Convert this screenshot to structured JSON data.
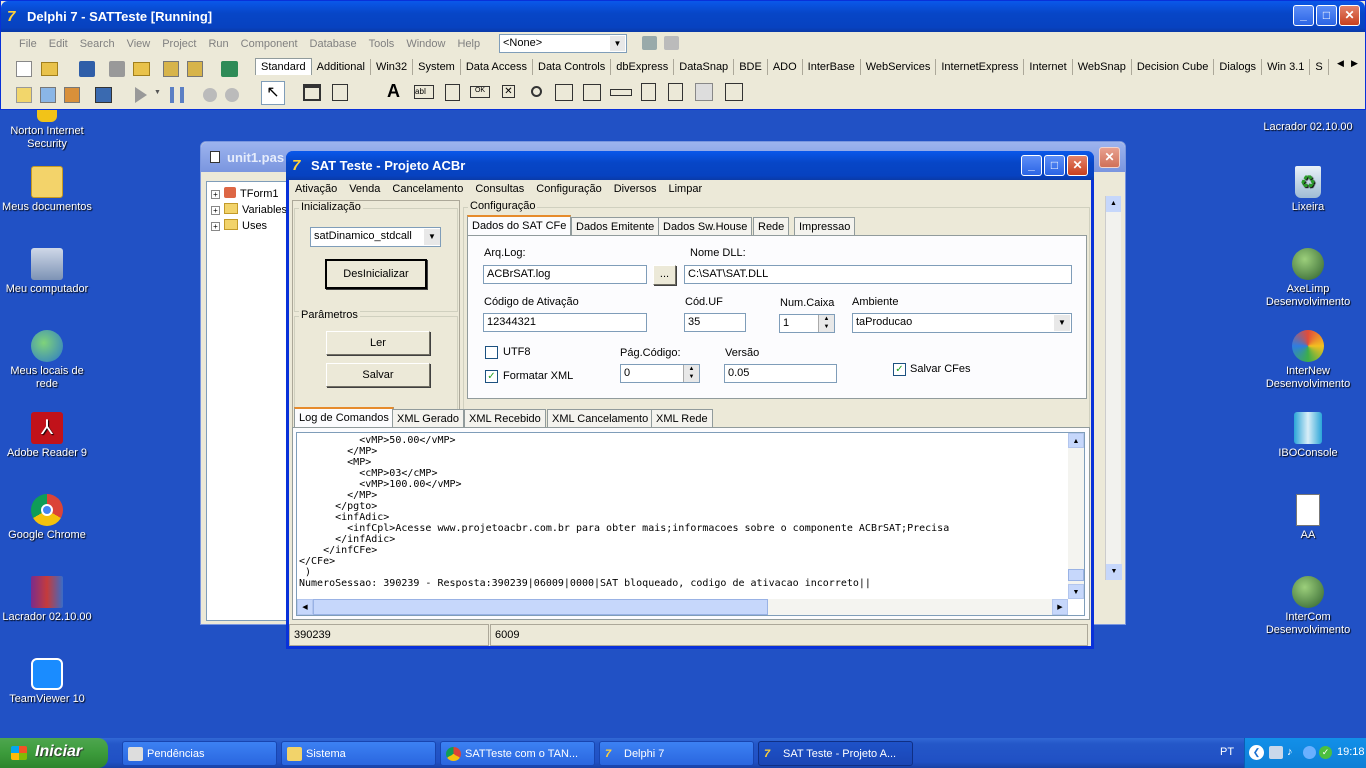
{
  "ide": {
    "title": "Delphi 7 - SATTeste [Running]",
    "menu": [
      "File",
      "Edit",
      "Search",
      "View",
      "Project",
      "Run",
      "Component",
      "Database",
      "Tools",
      "Window",
      "Help"
    ],
    "combo_value": "<None>",
    "palette_tabs": [
      "Standard",
      "Additional",
      "Win32",
      "System",
      "Data Access",
      "Data Controls",
      "dbExpress",
      "DataSnap",
      "BDE",
      "ADO",
      "InterBase",
      "WebServices",
      "InternetExpress",
      "Internet",
      "WebSnap",
      "Decision Cube",
      "Dialogs",
      "Win 3.1",
      "S"
    ]
  },
  "desktop": {
    "left_icons": [
      "Norton Internet Security",
      "Meus documentos",
      "Meu computador",
      "Meus locais de rede",
      "Adobe Reader 9",
      "Google Chrome",
      "Lacrador 02.10.00",
      "TeamViewer 10"
    ],
    "right_top_label": "Lacrador 02.10.00",
    "right_icons": [
      "Lixeira",
      "AxeLimp Desenvolvimento",
      "InterNew Desenvolvimento",
      "IBOConsole",
      "AA",
      "InterCom Desenvolvimento"
    ]
  },
  "unit_window": {
    "title": "unit1.pas",
    "tree": [
      "TForm1",
      "Variables",
      "Uses"
    ]
  },
  "app": {
    "title": "SAT Teste - Projeto ACBr",
    "menu": [
      "Ativação",
      "Venda",
      "Cancelamento",
      "Consultas",
      "Configuração",
      "Diversos",
      "Limpar"
    ],
    "init_group": "Inicialização",
    "lib_combo": "satDinamico_stdcall",
    "deinit_button": "DesInicializar",
    "params_group": "Parâmetros",
    "read_button": "Ler",
    "save_button": "Salvar",
    "config_group": "Configuração",
    "config_tabs": [
      "Dados do SAT CFe",
      "Dados Emitente",
      "Dados Sw.House",
      "Rede",
      "Impressao"
    ],
    "fields": {
      "arqlog_label": "Arq.Log:",
      "arqlog_value": "ACBrSAT.log",
      "browse": "...",
      "dll_label": "Nome DLL:",
      "dll_value": "C:\\SAT\\SAT.DLL",
      "ativacao_label": "Código de Ativação",
      "ativacao_value": "12344321",
      "coduf_label": "Cód.UF",
      "coduf_value": "35",
      "numcaixa_label": "Num.Caixa",
      "numcaixa_value": "1",
      "ambiente_label": "Ambiente",
      "ambiente_value": "taProducao",
      "utf8_label": "UTF8",
      "formatar_label": "Formatar XML",
      "pagcod_label": "Pág.Código:",
      "pagcod_value": "0",
      "versao_label": "Versão",
      "versao_value": "0.05",
      "salvar_label": "Salvar CFes",
      "check_mark": "✓"
    },
    "log_tabs": [
      "Log de Comandos",
      "XML Gerado",
      "XML Recebido",
      "XML Cancelamento",
      "XML Rede"
    ],
    "log_lines": [
      "          <vMP>50.00</vMP>",
      "        </MP>",
      "        <MP>",
      "          <cMP>03</cMP>",
      "          <vMP>100.00</vMP>",
      "        </MP>",
      "      </pgto>",
      "      <infAdic>",
      "        <infCpl>Acesse www.projetoacbr.com.br para obter mais;informacoes sobre o componente ACBrSAT;Precisa",
      "      </infAdic>",
      "    </infCFe>",
      "</CFe>",
      " )",
      "NumeroSessao: 390239 - Resposta:390239|06009|0000|SAT bloqueado, codigo de ativacao incorreto||"
    ],
    "status": [
      "390239",
      "6009"
    ]
  },
  "taskbar": {
    "start": "Iniciar",
    "items": [
      "Pendências",
      "Sistema",
      "SATTeste com o TAN...",
      "Delphi 7",
      "SAT Teste - Projeto A..."
    ],
    "lang": "PT",
    "clock": "19:18"
  }
}
